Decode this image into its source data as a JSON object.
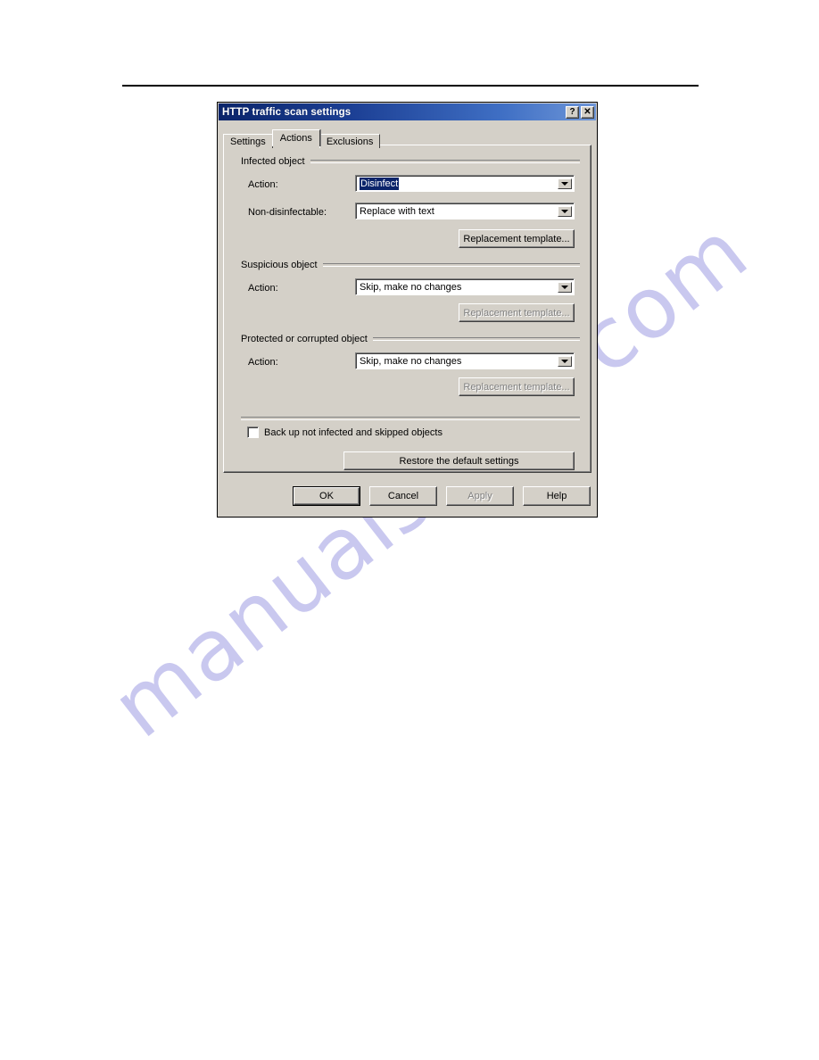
{
  "document": {
    "watermark": "manualshive.com"
  },
  "dialog": {
    "title": "HTTP traffic scan settings",
    "titlebar_buttons": [
      {
        "name": "help-icon",
        "glyph": "?"
      },
      {
        "name": "close-icon",
        "glyph": "✕"
      }
    ],
    "tabs": [
      {
        "label": "Settings",
        "selected": false
      },
      {
        "label": "Actions",
        "selected": true
      },
      {
        "label": "Exclusions",
        "selected": false
      }
    ],
    "groups": [
      {
        "header": "Infected object",
        "rows": [
          {
            "label": "Action:",
            "value": "Disinfect",
            "focused": true
          },
          {
            "label": "Non-disinfectable:",
            "value": "Replace with text",
            "focused": false
          }
        ],
        "button": {
          "label": "Replacement template...",
          "disabled": false
        }
      },
      {
        "header": "Suspicious object",
        "rows": [
          {
            "label": "Action:",
            "value": "Skip, make no changes",
            "focused": false
          }
        ],
        "button": {
          "label": "Replacement template...",
          "disabled": true
        }
      },
      {
        "header": "Protected or corrupted object",
        "rows": [
          {
            "label": "Action:",
            "value": "Skip, make no changes",
            "focused": false
          }
        ],
        "button": {
          "label": "Replacement template...",
          "disabled": true
        }
      }
    ],
    "backup_checkbox": {
      "label": "Back up not infected and skipped objects",
      "checked": false
    },
    "restore_button": {
      "label": "Restore the default settings"
    },
    "footer_buttons": [
      {
        "label": "OK",
        "disabled": false,
        "default": true
      },
      {
        "label": "Cancel",
        "disabled": false,
        "default": false
      },
      {
        "label": "Apply",
        "disabled": true,
        "default": false
      },
      {
        "label": "Help",
        "disabled": false,
        "default": false
      }
    ],
    "colors": {
      "face": "#d4d0c8",
      "titlebar_start": "#0a246a",
      "titlebar_end": "#6e96d8",
      "selection": "#0a246a",
      "disabled_text": "#808080",
      "watermark": "#c9c8ef"
    }
  }
}
